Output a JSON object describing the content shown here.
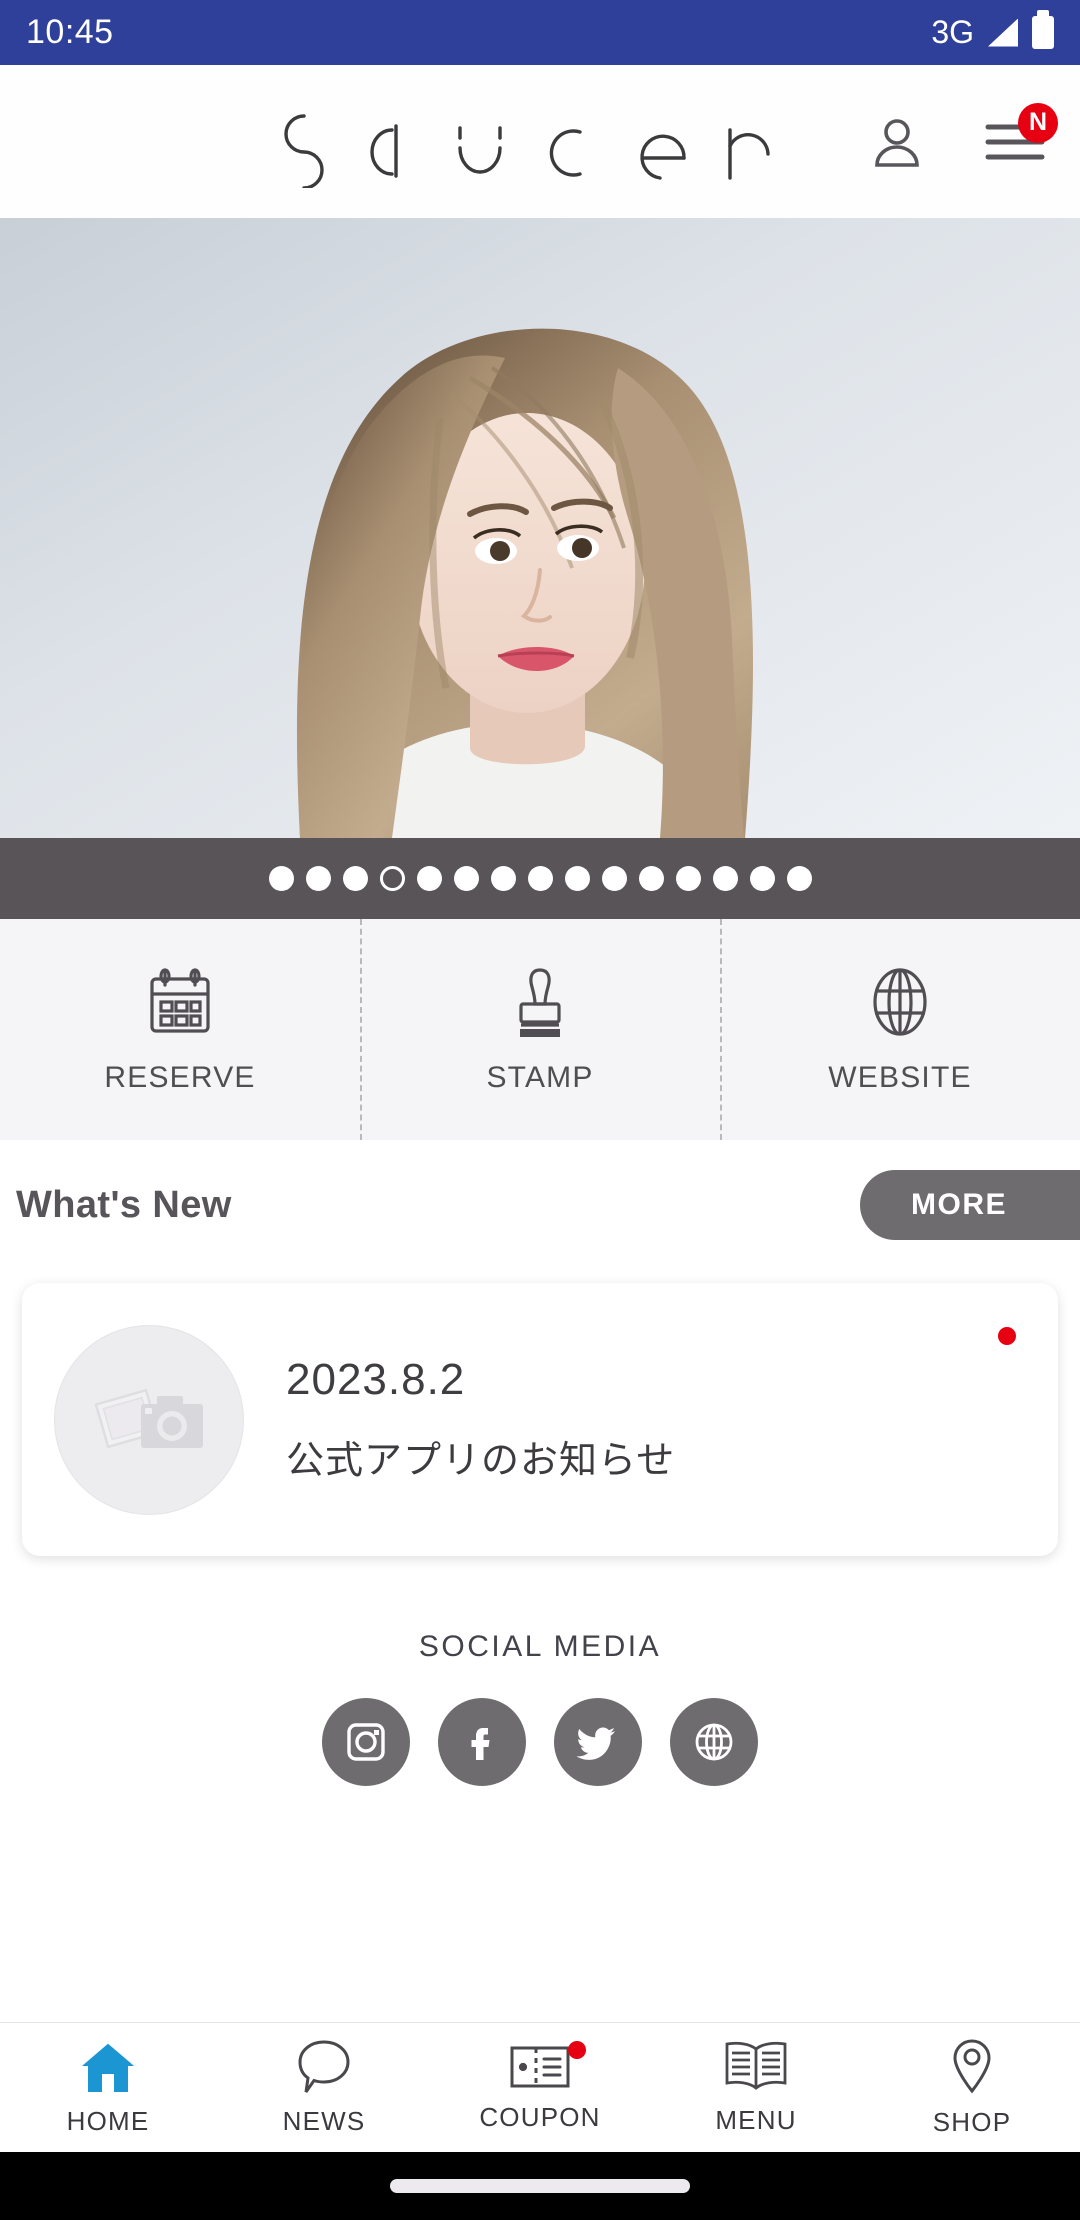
{
  "status_bar": {
    "time": "10:45",
    "network": "3G",
    "signal_icon": "signal-triangle-icon",
    "battery_icon": "battery-full-icon",
    "background_color": "#2f409b"
  },
  "header": {
    "logo_text": "saucer",
    "account_icon": "person-icon",
    "menu_icon": "hamburger-menu-icon",
    "menu_badge": "N",
    "badge_color": "#e60012"
  },
  "hero": {
    "alt": "hair-salon-model-photo",
    "description": "Woman with long light-brown wavy hair against pale wall"
  },
  "carousel": {
    "total_slides": 15,
    "active_index": 3,
    "bar_color": "#585457"
  },
  "quick_actions": [
    {
      "label": "RESERVE",
      "icon": "calendar-icon"
    },
    {
      "label": "STAMP",
      "icon": "stamp-icon"
    },
    {
      "label": "WEBSITE",
      "icon": "globe-icon"
    }
  ],
  "whats_new": {
    "title": "What's New",
    "more_label": "MORE",
    "more_button_color": "#6f6c70"
  },
  "news_items": [
    {
      "date": "2023.8.2",
      "title": "公式アプリのお知らせ",
      "thumbnail_icon": "photo-camera-placeholder-icon",
      "unread": true,
      "unread_dot_color": "#e60012"
    }
  ],
  "social_media": {
    "title": "SOCIAL MEDIA",
    "icon_bg_color": "#6f6c70",
    "items": [
      {
        "name": "Instagram",
        "icon": "instagram-icon"
      },
      {
        "name": "Facebook",
        "icon": "facebook-icon"
      },
      {
        "name": "Twitter",
        "icon": "twitter-icon"
      },
      {
        "name": "Website",
        "icon": "globe-icon"
      }
    ]
  },
  "bottom_nav": {
    "active_color": "#1b96d2",
    "items": [
      {
        "label": "HOME",
        "icon": "home-icon",
        "active": true,
        "badge": false
      },
      {
        "label": "NEWS",
        "icon": "speech-bubble-icon",
        "active": false,
        "badge": false
      },
      {
        "label": "COUPON",
        "icon": "coupon-ticket-icon",
        "active": false,
        "badge": true
      },
      {
        "label": "MENU",
        "icon": "open-book-icon",
        "active": false,
        "badge": false
      },
      {
        "label": "SHOP",
        "icon": "location-pin-icon",
        "active": false,
        "badge": false
      }
    ]
  },
  "gesture_bar": {
    "handle": "home-gesture-handle"
  }
}
